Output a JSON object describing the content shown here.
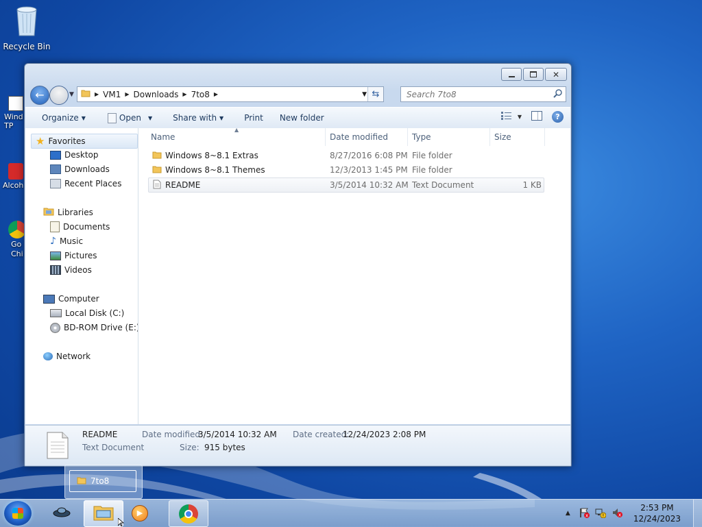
{
  "desktop": {
    "recycle_bin": "Recycle Bin",
    "partial_labels": [
      "Wind TP",
      "Alcoh",
      "Go Chi"
    ]
  },
  "window": {
    "address": {
      "crumbs": [
        "VM1",
        "Downloads",
        "7to8"
      ]
    },
    "search": {
      "placeholder": "Search 7to8"
    },
    "toolbar": {
      "organize": "Organize",
      "open": "Open",
      "share_with": "Share with",
      "print": "Print",
      "new_folder": "New folder"
    },
    "nav": {
      "favorites": "Favorites",
      "desktop": "Desktop",
      "downloads": "Downloads",
      "recent_places": "Recent Places",
      "libraries": "Libraries",
      "documents": "Documents",
      "music": "Music",
      "pictures": "Pictures",
      "videos": "Videos",
      "computer": "Computer",
      "local_disk": "Local Disk (C:)",
      "bd_rom": "BD-ROM Drive (E:) C",
      "network": "Network"
    },
    "columns": {
      "name": "Name",
      "date": "Date modified",
      "type": "Type",
      "size": "Size"
    },
    "files": [
      {
        "name": "Windows 8~8.1 Extras",
        "date": "8/27/2016 6:08 PM",
        "type": "File folder",
        "size": ""
      },
      {
        "name": "Windows 8~8.1 Themes",
        "date": "12/3/2013 1:45 PM",
        "type": "File folder",
        "size": ""
      },
      {
        "name": "README",
        "date": "3/5/2014 10:32 AM",
        "type": "Text Document",
        "size": "1 KB"
      }
    ],
    "details": {
      "name": "README",
      "type": "Text Document",
      "date_modified_label": "Date modified:",
      "date_modified": "3/5/2014 10:32 AM",
      "date_created_label": "Date created:",
      "date_created": "12/24/2023 2:08 PM",
      "size_label": "Size:",
      "size": "915 bytes"
    }
  },
  "taskbar": {
    "thumbnail_label": "7to8",
    "clock_time": "2:53 PM",
    "clock_date": "12/24/2023"
  }
}
